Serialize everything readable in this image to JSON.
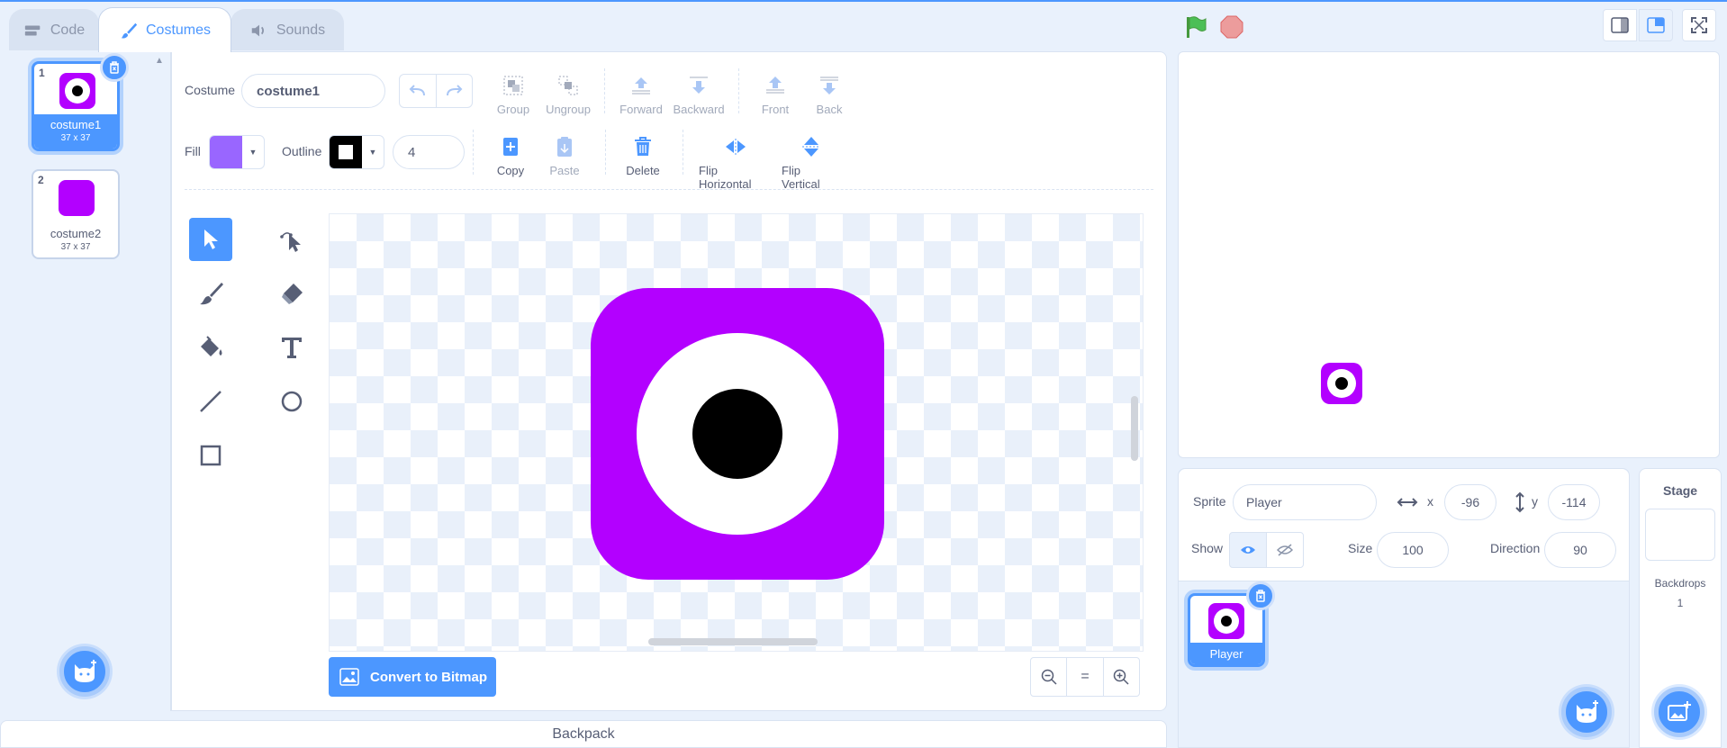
{
  "tabs": {
    "code": "Code",
    "costumes": "Costumes",
    "sounds": "Sounds"
  },
  "costumes": [
    {
      "number": "1",
      "name": "costume1",
      "size": "37 x 37"
    },
    {
      "number": "2",
      "name": "costume2",
      "size": "37 x 37"
    }
  ],
  "editor": {
    "costume_label": "Costume",
    "costume_name": "costume1",
    "group": "Group",
    "ungroup": "Ungroup",
    "forward": "Forward",
    "backward": "Backward",
    "front": "Front",
    "back": "Back",
    "fill_label": "Fill",
    "outline_label": "Outline",
    "outline_width": "4",
    "copy": "Copy",
    "paste": "Paste",
    "delete": "Delete",
    "flip_horizontal": "Flip Horizontal",
    "flip_vertical": "Flip Vertical",
    "convert_bitmap": "Convert to Bitmap",
    "zoom_reset": "="
  },
  "colors": {
    "fill": "#9966ff",
    "outline": "#000000",
    "costume": "#b300ff",
    "accent": "#4c97ff"
  },
  "backpack": "Backpack",
  "sprite": {
    "label": "Sprite",
    "name": "Player",
    "x_label": "x",
    "x": "-96",
    "y_label": "y",
    "y": "-114",
    "show_label": "Show",
    "size_label": "Size",
    "size": "100",
    "direction_label": "Direction",
    "direction": "90",
    "tile_name": "Player"
  },
  "stage_panel": {
    "title": "Stage",
    "backdrops_label": "Backdrops",
    "backdrops_count": "1"
  }
}
